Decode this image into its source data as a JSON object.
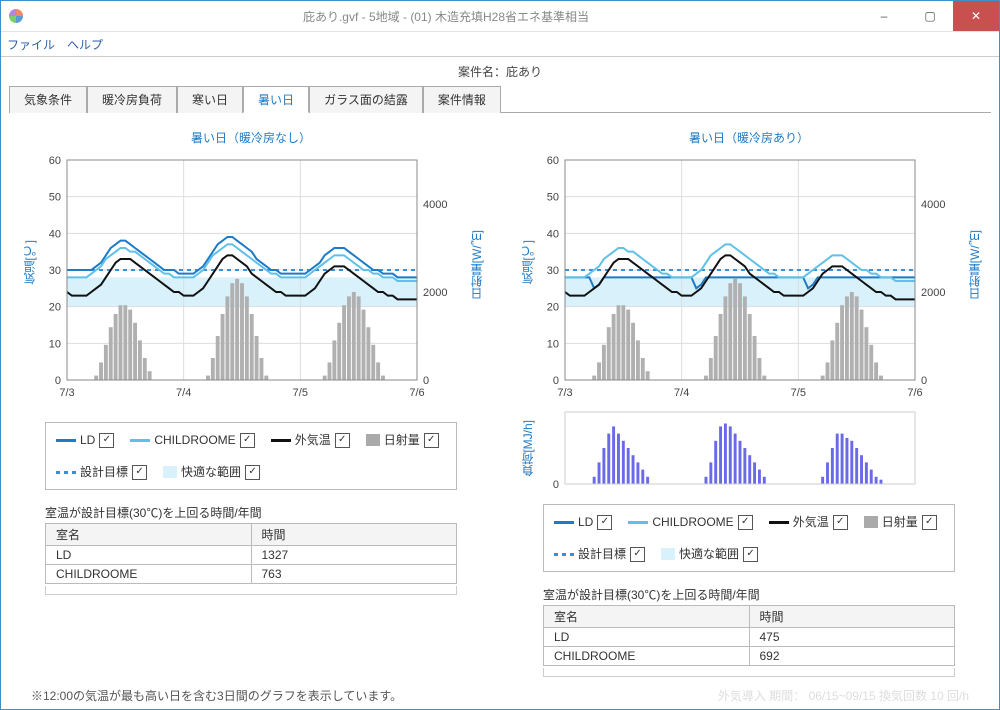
{
  "window": {
    "title": "庇あり.gvf - 5地域 - (01) 木造充填H28省エネ基準相当",
    "minimize": "–",
    "maximize": "▢",
    "close": "✕"
  },
  "menu": {
    "file": "ファイル",
    "help": "ヘルプ"
  },
  "case_label": "案件名：庇あり",
  "tabs": [
    "気象条件",
    "暖冷房負荷",
    "寒い日",
    "暑い日",
    "ガラス面の結露",
    "案件情報"
  ],
  "active_tab_index": 3,
  "legend": {
    "ld": "LD",
    "ch": "CHILDROOME",
    "out": "外気温",
    "solar": "日射量",
    "target": "設計目標",
    "comfort": "快適な範囲"
  },
  "chk_mark": "✓",
  "table": {
    "caption": "室温が設計目標(30℃)を上回る時間/年間",
    "head_room": "室名",
    "head_time": "時間",
    "left": [
      [
        "LD",
        "1327"
      ],
      [
        "CHILDROOME",
        "763"
      ]
    ],
    "right": [
      [
        "LD",
        "475"
      ],
      [
        "CHILDROOME",
        "692"
      ]
    ]
  },
  "foot_left": "※12:00の気温が最も高い日を含む3日間のグラフを表示しています。",
  "foot_right": "外気導入   期間：      06/15~09/15     換気回数     10   回/h",
  "chart_data": [
    {
      "type": "line",
      "title": "暑い日（暖冷房なし）",
      "xlabel": "",
      "ylabel_left": "気温[℃]",
      "ylabel_right": "日射量[W/㎡]",
      "xticks": [
        "7/3",
        "7/4",
        "7/5",
        "7/6"
      ],
      "yticks_left": [
        0,
        10,
        20,
        30,
        40,
        50,
        60
      ],
      "yticks_right": [
        0,
        2000,
        4000
      ],
      "ylim_left": [
        0,
        60
      ],
      "ylim_right": [
        0,
        5000
      ],
      "design_target": 30,
      "comfort_band": [
        20,
        28
      ],
      "x": [
        0,
        1,
        2,
        3,
        4,
        5,
        6,
        7,
        8,
        9,
        10,
        11,
        12,
        13,
        14,
        15,
        16,
        17,
        18,
        19,
        20,
        21,
        22,
        23,
        24,
        25,
        26,
        27,
        28,
        29,
        30,
        31,
        32,
        33,
        34,
        35,
        36,
        37,
        38,
        39,
        40,
        41,
        42,
        43,
        44,
        45,
        46,
        47,
        48,
        49,
        50,
        51,
        52,
        53,
        54,
        55,
        56,
        57,
        58,
        59,
        60,
        61,
        62,
        63,
        64,
        65,
        66,
        67,
        68,
        69,
        70,
        71,
        72
      ],
      "series": [
        {
          "name": "LD",
          "color": "#1e7bc7",
          "values": [
            30,
            30,
            30,
            30,
            30,
            30,
            31,
            32,
            34,
            36,
            37,
            38,
            38,
            37,
            36,
            35,
            34,
            33,
            32,
            31,
            30,
            30,
            30,
            29,
            29,
            29,
            29,
            30,
            31,
            33,
            35,
            37,
            38,
            39,
            39,
            38,
            37,
            36,
            35,
            33,
            32,
            31,
            30,
            30,
            29,
            29,
            29,
            29,
            29,
            29,
            30,
            31,
            32,
            34,
            35,
            36,
            36,
            36,
            35,
            34,
            33,
            32,
            31,
            30,
            30,
            29,
            29,
            29,
            28,
            28,
            28,
            28,
            28
          ]
        },
        {
          "name": "CHILDROOME",
          "color": "#5fc1e8",
          "values": [
            28,
            28,
            28,
            28,
            28,
            29,
            30,
            31,
            33,
            34,
            35,
            36,
            36,
            35,
            35,
            34,
            33,
            32,
            31,
            30,
            29,
            29,
            28,
            28,
            28,
            28,
            28,
            29,
            30,
            32,
            34,
            35,
            36,
            37,
            37,
            36,
            35,
            34,
            33,
            32,
            31,
            30,
            29,
            29,
            28,
            28,
            28,
            28,
            28,
            28,
            29,
            30,
            31,
            32,
            33,
            34,
            34,
            34,
            33,
            32,
            31,
            30,
            30,
            29,
            29,
            28,
            28,
            28,
            27,
            27,
            27,
            27,
            27
          ]
        },
        {
          "name": "外気温",
          "color": "#111",
          "values": [
            24,
            23,
            23,
            23,
            23,
            24,
            25,
            26,
            28,
            30,
            32,
            33,
            33,
            33,
            32,
            31,
            30,
            29,
            28,
            27,
            26,
            25,
            24,
            24,
            23,
            23,
            23,
            24,
            25,
            27,
            29,
            31,
            33,
            34,
            34,
            33,
            32,
            31,
            29,
            28,
            27,
            26,
            25,
            24,
            24,
            23,
            23,
            23,
            23,
            23,
            24,
            25,
            27,
            29,
            30,
            31,
            31,
            31,
            30,
            29,
            28,
            27,
            26,
            25,
            24,
            24,
            23,
            23,
            22,
            22,
            22,
            22,
            22
          ]
        }
      ],
      "solar_bars": [
        0,
        0,
        0,
        0,
        0,
        0,
        100,
        400,
        800,
        1200,
        1500,
        1700,
        1700,
        1600,
        1300,
        900,
        500,
        200,
        0,
        0,
        0,
        0,
        0,
        0,
        0,
        0,
        0,
        0,
        0,
        100,
        500,
        1000,
        1500,
        1900,
        2200,
        2300,
        2200,
        1900,
        1500,
        1000,
        500,
        100,
        0,
        0,
        0,
        0,
        0,
        0,
        0,
        0,
        0,
        0,
        0,
        100,
        400,
        900,
        1300,
        1700,
        1900,
        2000,
        1900,
        1600,
        1200,
        800,
        400,
        100,
        0,
        0,
        0,
        0,
        0,
        0,
        0
      ]
    },
    {
      "type": "line",
      "title": "暑い日（暖冷房あり）",
      "xlabel": "",
      "ylabel_left": "気温[℃]",
      "ylabel_right": "日射量[W/㎡]",
      "xticks": [
        "7/3",
        "7/4",
        "7/5",
        "7/6"
      ],
      "yticks_left": [
        0,
        10,
        20,
        30,
        40,
        50,
        60
      ],
      "yticks_right": [
        0,
        2000,
        4000
      ],
      "ylim_left": [
        0,
        60
      ],
      "ylim_right": [
        0,
        5000
      ],
      "design_target": 30,
      "comfort_band": [
        20,
        28
      ],
      "x": [
        0,
        1,
        2,
        3,
        4,
        5,
        6,
        7,
        8,
        9,
        10,
        11,
        12,
        13,
        14,
        15,
        16,
        17,
        18,
        19,
        20,
        21,
        22,
        23,
        24,
        25,
        26,
        27,
        28,
        29,
        30,
        31,
        32,
        33,
        34,
        35,
        36,
        37,
        38,
        39,
        40,
        41,
        42,
        43,
        44,
        45,
        46,
        47,
        48,
        49,
        50,
        51,
        52,
        53,
        54,
        55,
        56,
        57,
        58,
        59,
        60,
        61,
        62,
        63,
        64,
        65,
        66,
        67,
        68,
        69,
        70,
        71,
        72
      ],
      "series": [
        {
          "name": "LD",
          "color": "#1e7bc7",
          "values": [
            28,
            28,
            28,
            28,
            28,
            28,
            25,
            26,
            28,
            28,
            28,
            28,
            28,
            28,
            28,
            28,
            28,
            28,
            28,
            28,
            28,
            28,
            28,
            28,
            28,
            28,
            28,
            25,
            26,
            28,
            28,
            28,
            28,
            28,
            28,
            28,
            28,
            28,
            28,
            28,
            28,
            28,
            28,
            28,
            28,
            28,
            28,
            28,
            28,
            28,
            25,
            26,
            28,
            28,
            28,
            28,
            28,
            28,
            28,
            28,
            28,
            28,
            28,
            28,
            28,
            28,
            28,
            28,
            28,
            28,
            28,
            28,
            28
          ]
        },
        {
          "name": "CHILDROOME",
          "color": "#5fc1e8",
          "values": [
            28,
            28,
            28,
            28,
            28,
            29,
            30,
            31,
            33,
            34,
            35,
            36,
            36,
            35,
            35,
            34,
            33,
            32,
            31,
            30,
            29,
            29,
            28,
            28,
            28,
            28,
            28,
            29,
            30,
            32,
            34,
            35,
            36,
            37,
            37,
            36,
            35,
            34,
            33,
            32,
            31,
            30,
            29,
            29,
            28,
            28,
            28,
            28,
            28,
            28,
            29,
            30,
            31,
            32,
            33,
            34,
            34,
            34,
            33,
            32,
            31,
            30,
            30,
            29,
            29,
            28,
            28,
            28,
            27,
            27,
            27,
            27,
            27
          ]
        },
        {
          "name": "外気温",
          "color": "#111",
          "values": [
            24,
            23,
            23,
            23,
            23,
            24,
            25,
            26,
            28,
            30,
            32,
            33,
            33,
            33,
            32,
            31,
            30,
            29,
            28,
            27,
            26,
            25,
            24,
            24,
            23,
            23,
            23,
            24,
            25,
            27,
            29,
            31,
            33,
            34,
            34,
            33,
            32,
            31,
            29,
            28,
            27,
            26,
            25,
            24,
            24,
            23,
            23,
            23,
            23,
            23,
            24,
            25,
            27,
            29,
            30,
            31,
            31,
            31,
            30,
            29,
            28,
            27,
            26,
            25,
            24,
            24,
            23,
            23,
            22,
            22,
            22,
            22,
            22
          ]
        }
      ],
      "solar_bars": [
        0,
        0,
        0,
        0,
        0,
        0,
        100,
        400,
        800,
        1200,
        1500,
        1700,
        1700,
        1600,
        1300,
        900,
        500,
        200,
        0,
        0,
        0,
        0,
        0,
        0,
        0,
        0,
        0,
        0,
        0,
        100,
        500,
        1000,
        1500,
        1900,
        2200,
        2300,
        2200,
        1900,
        1500,
        1000,
        500,
        100,
        0,
        0,
        0,
        0,
        0,
        0,
        0,
        0,
        0,
        0,
        0,
        100,
        400,
        900,
        1300,
        1700,
        1900,
        2000,
        1900,
        1600,
        1200,
        800,
        400,
        100,
        0,
        0,
        0,
        0,
        0,
        0,
        0
      ],
      "load_chart": {
        "type": "bar",
        "ylabel": "負荷[MJ/h]",
        "ylim": [
          0,
          5
        ],
        "values": [
          0,
          0,
          0,
          0,
          0,
          0,
          0.5,
          1.5,
          2.5,
          3.5,
          4,
          3.5,
          3,
          2.5,
          2,
          1.5,
          1,
          0.5,
          0,
          0,
          0,
          0,
          0,
          0,
          0,
          0,
          0,
          0,
          0,
          0.5,
          1.5,
          3,
          4,
          4.2,
          4,
          3.5,
          3,
          2.5,
          2,
          1.5,
          1,
          0.5,
          0,
          0,
          0,
          0,
          0,
          0,
          0,
          0,
          0,
          0,
          0,
          0.5,
          1.5,
          2.5,
          3.5,
          3.5,
          3.2,
          3,
          2.5,
          2,
          1.5,
          1,
          0.5,
          0.3,
          0,
          0,
          0,
          0,
          0,
          0,
          0
        ]
      }
    }
  ]
}
